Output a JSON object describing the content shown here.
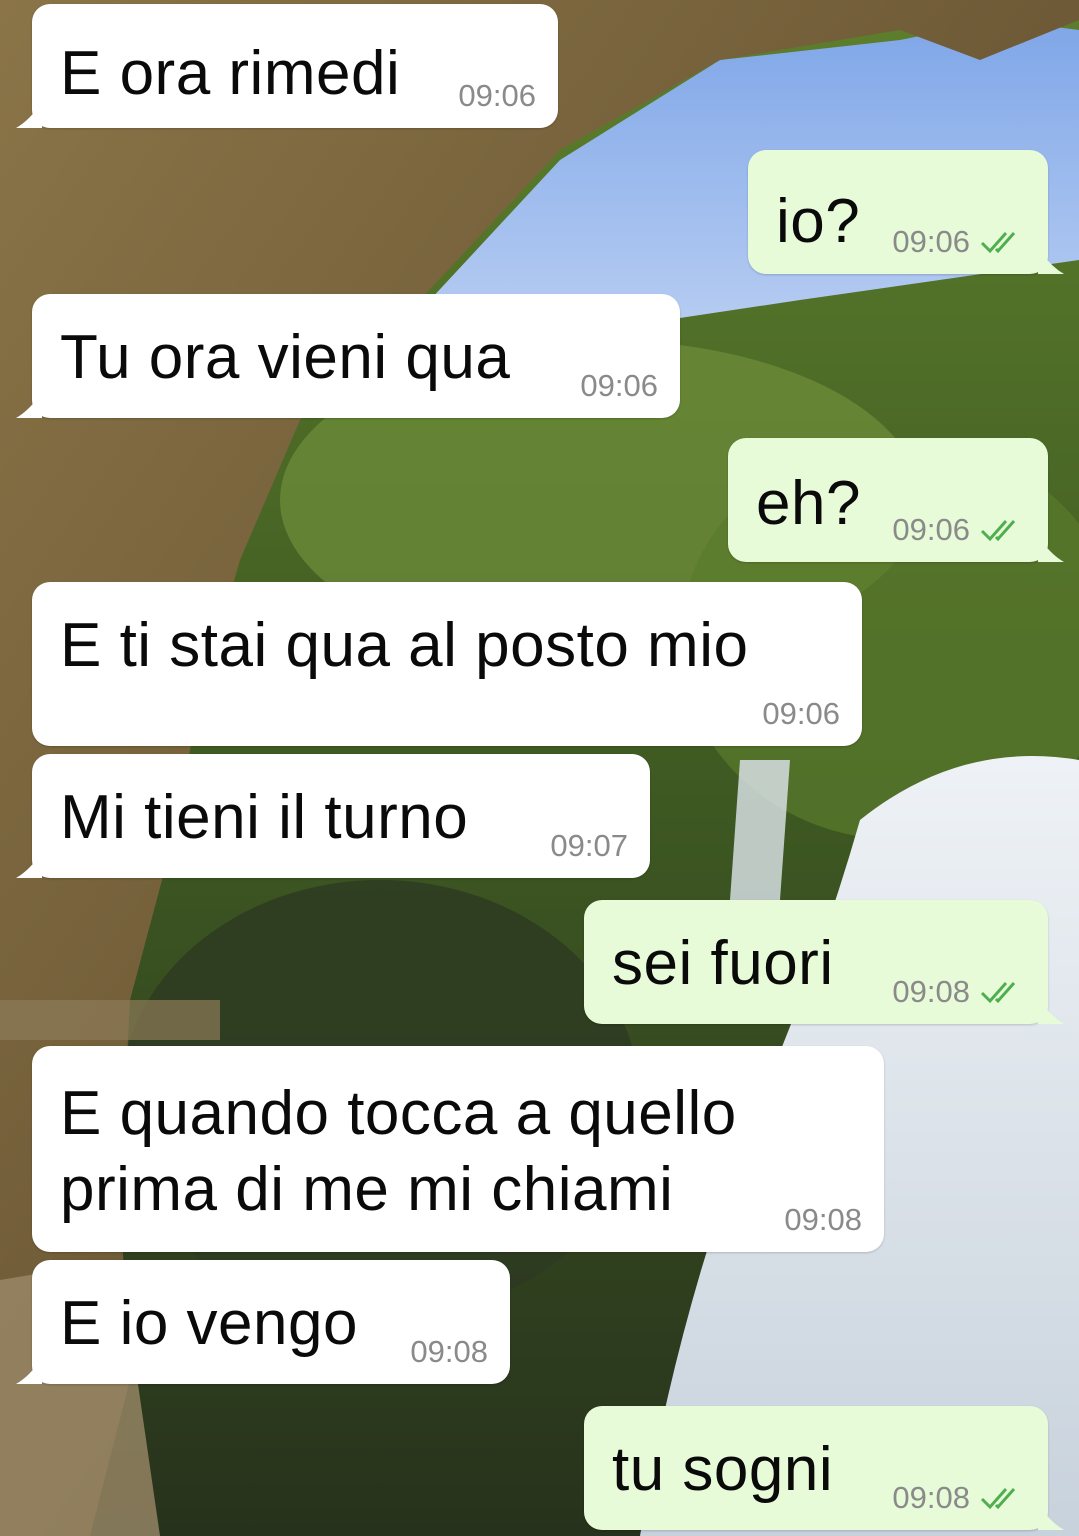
{
  "colors": {
    "incoming_bubble": "#ffffff",
    "outgoing_bubble": "#e8fbd8",
    "timestamp": "#8a8a8a",
    "read_ticks": "#4fae4f"
  },
  "icons": {
    "read_status": "double-check-icon"
  },
  "messages": [
    {
      "direction": "in",
      "text": "E ora rimedi",
      "time": "09:06"
    },
    {
      "direction": "out",
      "text": "io?",
      "time": "09:06"
    },
    {
      "direction": "in",
      "text": "Tu ora vieni qua",
      "time": "09:06"
    },
    {
      "direction": "out",
      "text": "eh?",
      "time": "09:06"
    },
    {
      "direction": "in",
      "text": "E ti stai qua al posto mio",
      "time": "09:06"
    },
    {
      "direction": "in",
      "text": "Mi tieni il turno",
      "time": "09:07"
    },
    {
      "direction": "out",
      "text": "sei fuori",
      "time": "09:08"
    },
    {
      "direction": "in",
      "text": "E quando tocca a quello\nprima di me mi chiami",
      "time": "09:08"
    },
    {
      "direction": "in",
      "text": "E io vengo",
      "time": "09:08"
    },
    {
      "direction": "out",
      "text": "tu sogni",
      "time": "09:08"
    }
  ]
}
